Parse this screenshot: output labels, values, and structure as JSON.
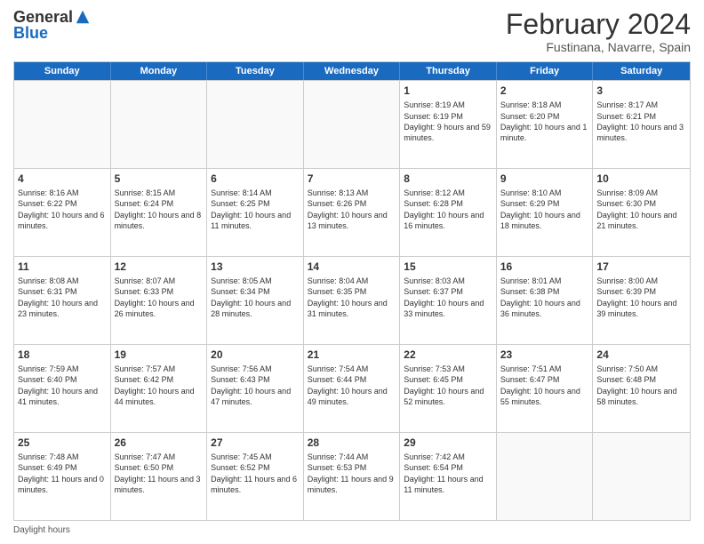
{
  "header": {
    "logo_general": "General",
    "logo_blue": "Blue",
    "month_year": "February 2024",
    "location": "Fustinana, Navarre, Spain"
  },
  "days_of_week": [
    "Sunday",
    "Monday",
    "Tuesday",
    "Wednesday",
    "Thursday",
    "Friday",
    "Saturday"
  ],
  "footer_label": "Daylight hours",
  "weeks": [
    [
      {
        "day": "",
        "data": ""
      },
      {
        "day": "",
        "data": ""
      },
      {
        "day": "",
        "data": ""
      },
      {
        "day": "",
        "data": ""
      },
      {
        "day": "1",
        "data": "Sunrise: 8:19 AM\nSunset: 6:19 PM\nDaylight: 9 hours and 59 minutes."
      },
      {
        "day": "2",
        "data": "Sunrise: 8:18 AM\nSunset: 6:20 PM\nDaylight: 10 hours and 1 minute."
      },
      {
        "day": "3",
        "data": "Sunrise: 8:17 AM\nSunset: 6:21 PM\nDaylight: 10 hours and 3 minutes."
      }
    ],
    [
      {
        "day": "4",
        "data": "Sunrise: 8:16 AM\nSunset: 6:22 PM\nDaylight: 10 hours and 6 minutes."
      },
      {
        "day": "5",
        "data": "Sunrise: 8:15 AM\nSunset: 6:24 PM\nDaylight: 10 hours and 8 minutes."
      },
      {
        "day": "6",
        "data": "Sunrise: 8:14 AM\nSunset: 6:25 PM\nDaylight: 10 hours and 11 minutes."
      },
      {
        "day": "7",
        "data": "Sunrise: 8:13 AM\nSunset: 6:26 PM\nDaylight: 10 hours and 13 minutes."
      },
      {
        "day": "8",
        "data": "Sunrise: 8:12 AM\nSunset: 6:28 PM\nDaylight: 10 hours and 16 minutes."
      },
      {
        "day": "9",
        "data": "Sunrise: 8:10 AM\nSunset: 6:29 PM\nDaylight: 10 hours and 18 minutes."
      },
      {
        "day": "10",
        "data": "Sunrise: 8:09 AM\nSunset: 6:30 PM\nDaylight: 10 hours and 21 minutes."
      }
    ],
    [
      {
        "day": "11",
        "data": "Sunrise: 8:08 AM\nSunset: 6:31 PM\nDaylight: 10 hours and 23 minutes."
      },
      {
        "day": "12",
        "data": "Sunrise: 8:07 AM\nSunset: 6:33 PM\nDaylight: 10 hours and 26 minutes."
      },
      {
        "day": "13",
        "data": "Sunrise: 8:05 AM\nSunset: 6:34 PM\nDaylight: 10 hours and 28 minutes."
      },
      {
        "day": "14",
        "data": "Sunrise: 8:04 AM\nSunset: 6:35 PM\nDaylight: 10 hours and 31 minutes."
      },
      {
        "day": "15",
        "data": "Sunrise: 8:03 AM\nSunset: 6:37 PM\nDaylight: 10 hours and 33 minutes."
      },
      {
        "day": "16",
        "data": "Sunrise: 8:01 AM\nSunset: 6:38 PM\nDaylight: 10 hours and 36 minutes."
      },
      {
        "day": "17",
        "data": "Sunrise: 8:00 AM\nSunset: 6:39 PM\nDaylight: 10 hours and 39 minutes."
      }
    ],
    [
      {
        "day": "18",
        "data": "Sunrise: 7:59 AM\nSunset: 6:40 PM\nDaylight: 10 hours and 41 minutes."
      },
      {
        "day": "19",
        "data": "Sunrise: 7:57 AM\nSunset: 6:42 PM\nDaylight: 10 hours and 44 minutes."
      },
      {
        "day": "20",
        "data": "Sunrise: 7:56 AM\nSunset: 6:43 PM\nDaylight: 10 hours and 47 minutes."
      },
      {
        "day": "21",
        "data": "Sunrise: 7:54 AM\nSunset: 6:44 PM\nDaylight: 10 hours and 49 minutes."
      },
      {
        "day": "22",
        "data": "Sunrise: 7:53 AM\nSunset: 6:45 PM\nDaylight: 10 hours and 52 minutes."
      },
      {
        "day": "23",
        "data": "Sunrise: 7:51 AM\nSunset: 6:47 PM\nDaylight: 10 hours and 55 minutes."
      },
      {
        "day": "24",
        "data": "Sunrise: 7:50 AM\nSunset: 6:48 PM\nDaylight: 10 hours and 58 minutes."
      }
    ],
    [
      {
        "day": "25",
        "data": "Sunrise: 7:48 AM\nSunset: 6:49 PM\nDaylight: 11 hours and 0 minutes."
      },
      {
        "day": "26",
        "data": "Sunrise: 7:47 AM\nSunset: 6:50 PM\nDaylight: 11 hours and 3 minutes."
      },
      {
        "day": "27",
        "data": "Sunrise: 7:45 AM\nSunset: 6:52 PM\nDaylight: 11 hours and 6 minutes."
      },
      {
        "day": "28",
        "data": "Sunrise: 7:44 AM\nSunset: 6:53 PM\nDaylight: 11 hours and 9 minutes."
      },
      {
        "day": "29",
        "data": "Sunrise: 7:42 AM\nSunset: 6:54 PM\nDaylight: 11 hours and 11 minutes."
      },
      {
        "day": "",
        "data": ""
      },
      {
        "day": "",
        "data": ""
      }
    ]
  ]
}
